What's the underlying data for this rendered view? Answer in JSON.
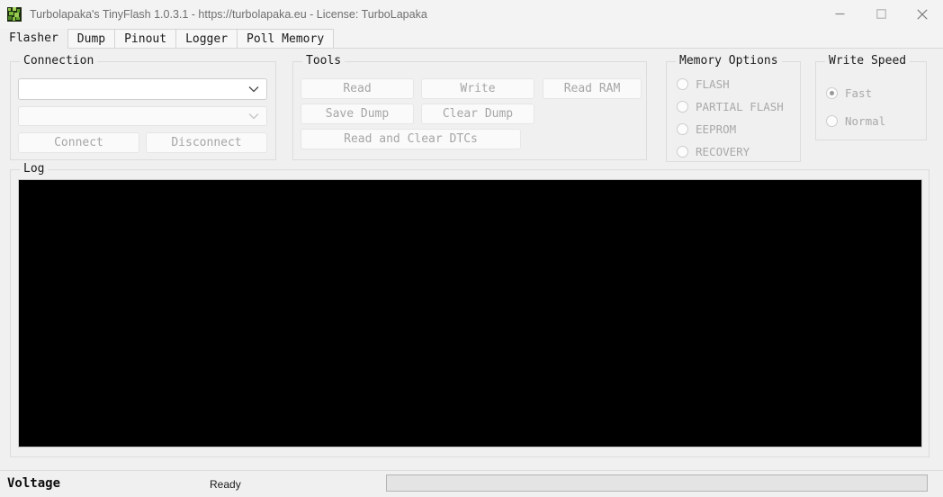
{
  "window": {
    "title": "Turbolapaka's TinyFlash 1.0.3.1 - https://turbolapaka.eu - License: TurboLapaka",
    "icon": "app-frog-icon",
    "controls": {
      "minimize": "minimize-icon",
      "maximize": "maximize-icon",
      "close": "close-icon"
    }
  },
  "tabs": [
    {
      "label": "Flasher",
      "active": true
    },
    {
      "label": "Dump",
      "active": false
    },
    {
      "label": "Pinout",
      "active": false
    },
    {
      "label": "Logger",
      "active": false
    },
    {
      "label": "Poll Memory",
      "active": false
    }
  ],
  "connection": {
    "title": "Connection",
    "device_combo": {
      "value": "",
      "placeholder": "",
      "enabled": true,
      "icon": "chevron-down-icon"
    },
    "baud_combo": {
      "value": "",
      "placeholder": "",
      "enabled": false,
      "icon": "chevron-down-icon"
    },
    "connect_label": "Connect",
    "disconnect_label": "Disconnect"
  },
  "tools": {
    "title": "Tools",
    "read_label": "Read",
    "write_label": "Write",
    "read_ram_label": "Read RAM",
    "save_dump_label": "Save Dump",
    "clear_dump_label": "Clear Dump",
    "read_clear_dtcs_label": "Read and Clear DTCs"
  },
  "memory_options": {
    "title": "Memory Options",
    "items": [
      {
        "label": "FLASH",
        "selected": false
      },
      {
        "label": "PARTIAL FLASH",
        "selected": false
      },
      {
        "label": "EEPROM",
        "selected": false
      },
      {
        "label": "RECOVERY",
        "selected": false
      }
    ]
  },
  "write_speed": {
    "title": "Write Speed",
    "items": [
      {
        "label": "Fast",
        "selected": true
      },
      {
        "label": "Normal",
        "selected": false
      }
    ]
  },
  "log": {
    "title": "Log",
    "content": ""
  },
  "statusbar": {
    "voltage_label": "Voltage",
    "status_text": "Ready",
    "progress_percent": 0
  },
  "colors": {
    "background": "#f0f0f0",
    "titlebar": "#f3f3f3",
    "log_background": "#000000",
    "disabled_text": "#a6a6a6",
    "title_text": "#6f6f6f",
    "progress_accent": "#06b025"
  }
}
